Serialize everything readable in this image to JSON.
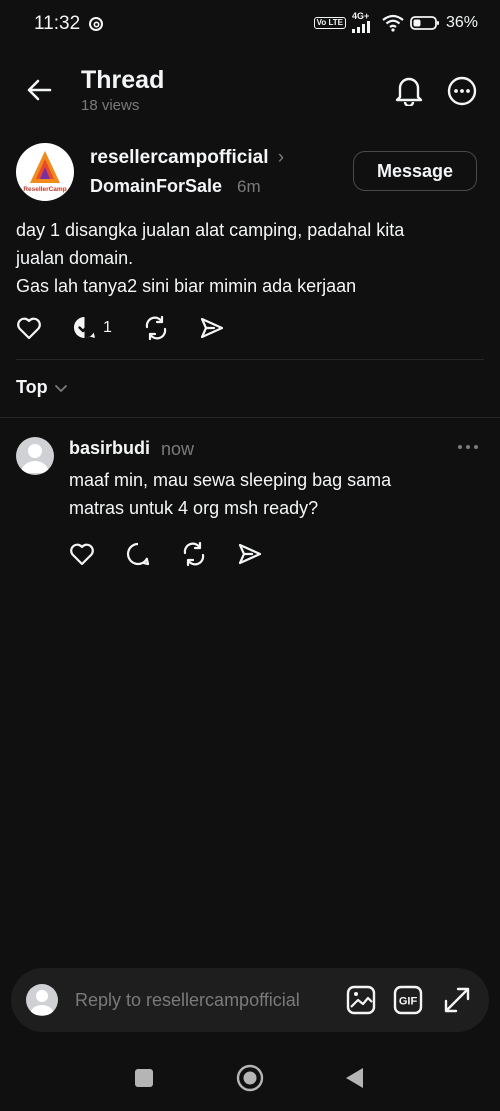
{
  "status_bar": {
    "time": "11:32",
    "network": "4G+",
    "volte": "Vo LTE",
    "battery": "36%"
  },
  "header": {
    "title": "Thread",
    "views": "18 views"
  },
  "post": {
    "username": "resellercampofficial",
    "tag": "DomainForSale",
    "time": "6m",
    "message_button": "Message",
    "text_lines": [
      "day 1 disangka jualan alat camping, padahal kita",
      "jualan domain.",
      "Gas lah tanya2 sini biar mimin ada kerjaan"
    ],
    "reply_count": "1",
    "avatar_logo_text": "ResellerCamp"
  },
  "sort": {
    "label": "Top"
  },
  "reply": {
    "username": "basirbudi",
    "time": "now",
    "text_lines": [
      "maaf min, mau sewa sleeping bag sama",
      "matras untuk 4 org msh ready?"
    ]
  },
  "composer": {
    "placeholder": "Reply to resellercampofficial"
  },
  "colors": {
    "background": "#101010",
    "text": "#f3f5f7",
    "secondary": "#7a7a7a",
    "divider": "#262626",
    "composer_bg": "#1e1e1e"
  }
}
